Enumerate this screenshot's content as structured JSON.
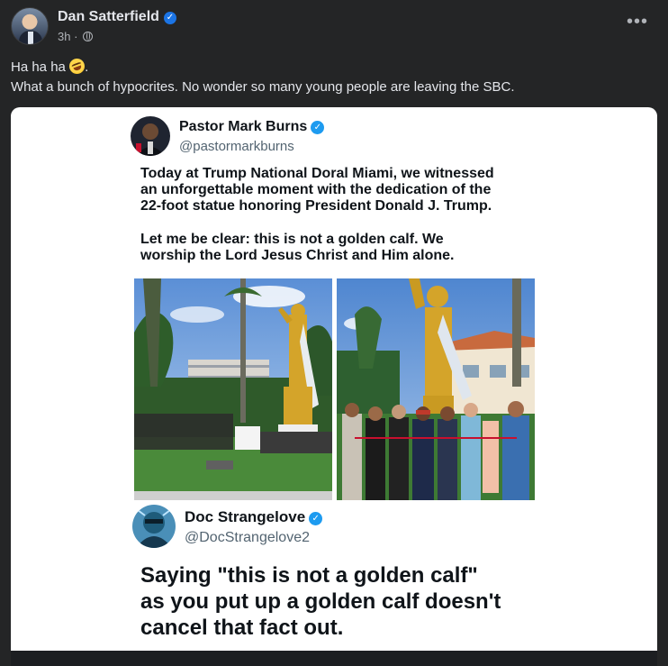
{
  "post": {
    "author": "Dan Satterfield",
    "time": "3h",
    "separator": "·",
    "more_label": "•••",
    "text_line1": "Ha ha ha",
    "text_line1_end": ".",
    "text_line2": "What a bunch of hypocrites. No wonder so many young people are leaving the SBC."
  },
  "shared_image": {
    "tweet1": {
      "name": "Pastor Mark Burns",
      "handle": "@pastormarkburns",
      "para1_l1": "Today at Trump National Doral Miami, we witnessed",
      "para1_l2": "an unforgettable moment with the dedication of the",
      "para1_l3": "22-foot statue honoring President Donald J. Trump.",
      "para2_l1": "Let me be clear: this is not a golden calf. We",
      "para2_l2": "worship the Lord Jesus Christ and Him alone."
    },
    "tweet2": {
      "name": "Doc Strangelove",
      "handle": "@DocStrangelove2",
      "body_l1": "Saying \"this is not a golden calf\"",
      "body_l2": "as you put up a golden calf doesn't",
      "body_l3": "cancel that fact out."
    }
  },
  "colors": {
    "background": "#242526",
    "verified_fb": "#1b74e4",
    "verified_x": "#1d9bf0",
    "gold": "#d4a42a"
  }
}
